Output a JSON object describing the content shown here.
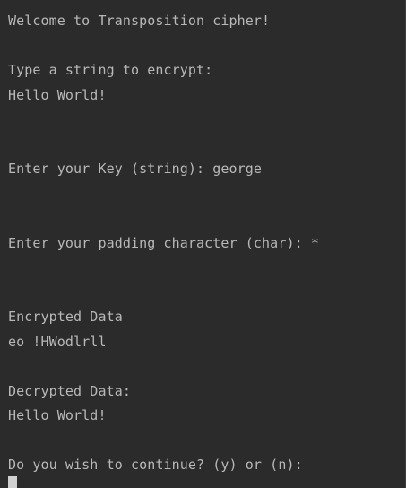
{
  "console": {
    "welcome": "Welcome to Transposition cipher!",
    "prompt_string": "Type a string to encrypt:",
    "input_string": "Hello World!",
    "prompt_key": "Enter your Key (string): ",
    "input_key": "george",
    "prompt_padding": "Enter your padding character (char): ",
    "input_padding": "*",
    "encrypted_label": "Encrypted Data",
    "encrypted_value": "eo !HWodlrll",
    "decrypted_label": "Decrypted Data:",
    "decrypted_value": "Hello World!",
    "prompt_continue": "Do you wish to continue? (y) or (n):"
  }
}
